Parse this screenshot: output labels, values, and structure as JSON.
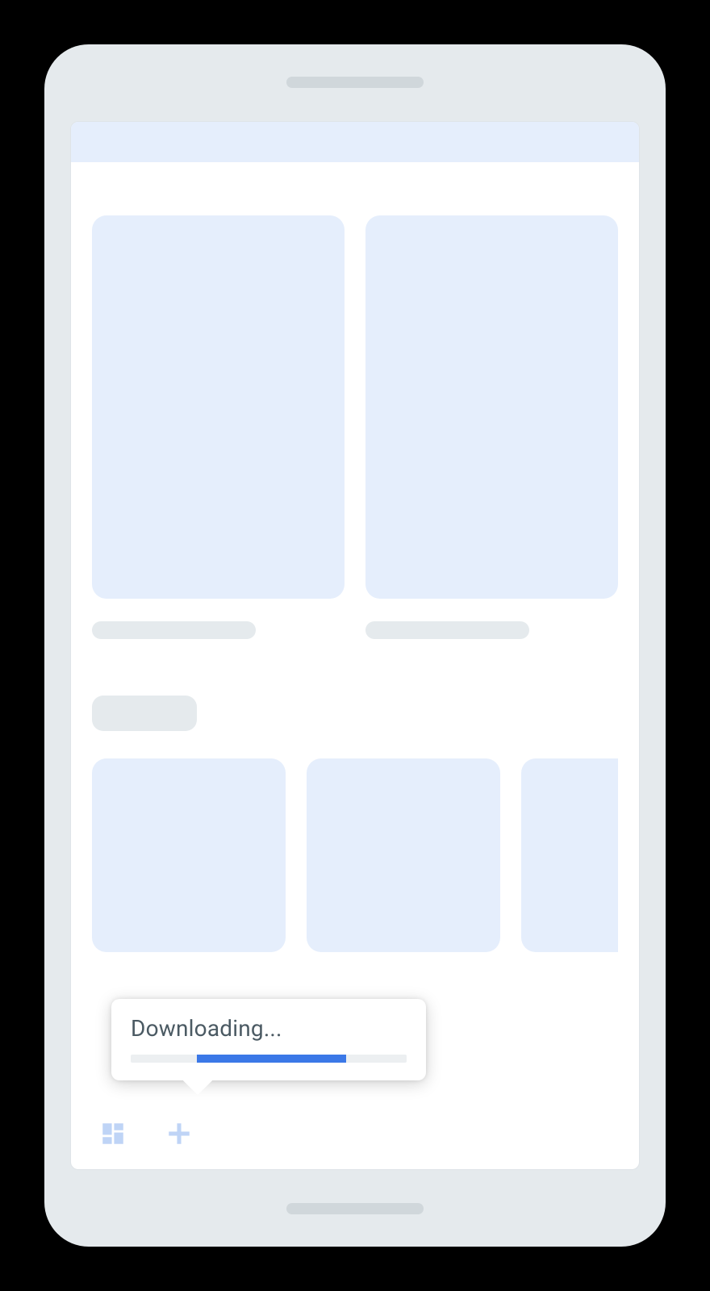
{
  "tooltip": {
    "label": "Downloading...",
    "progress": {
      "start_pct": 24,
      "end_pct": 78
    }
  },
  "colors": {
    "placeholder_card": "#e5eefc",
    "placeholder_bar": "#e5eaed",
    "accent": "#3b78e7",
    "icon": "#bfd4f6"
  },
  "nav": {
    "icons": [
      "dashboard-icon",
      "plus-icon"
    ]
  }
}
